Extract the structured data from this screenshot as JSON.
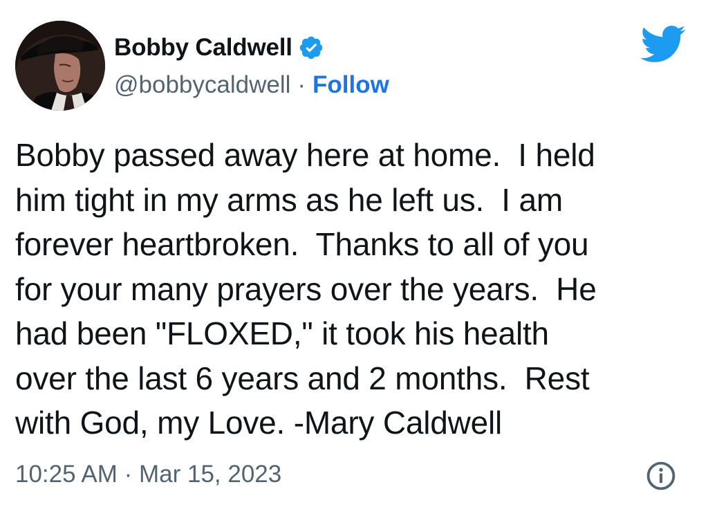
{
  "author": {
    "display_name": "Bobby Caldwell",
    "handle": "@bobbycaldwell",
    "separator": "·",
    "follow_label": "Follow",
    "verified": true,
    "avatar_icon": "profile-photo"
  },
  "tweet": {
    "text": "Bobby passed away here at home.  I held\nhim tight in my arms as he left us.  I am\nforever heartbroken.  Thanks to all of you\nfor your many prayers over the years.  He\nhad been \"FLOXED,\" it took his health\nover the last 6 years and 2 months.  Rest\nwith God, my Love. -Mary Caldwell",
    "timestamp": "10:25 AM · Mar 15, 2023"
  },
  "icons": {
    "brand": "twitter-bird-icon",
    "verified": "verified-badge-icon",
    "info": "info-icon"
  },
  "colors": {
    "brand_blue": "#1d9bf0",
    "link_blue": "#1d74e8",
    "secondary_text": "#536471",
    "primary_text": "#0f1419"
  }
}
